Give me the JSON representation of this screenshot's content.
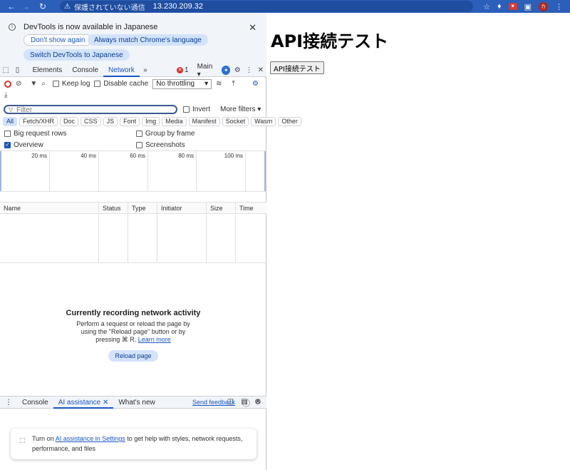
{
  "browser": {
    "security_warning": "保護されていない通信",
    "url": "13.230.209.32",
    "profile_initial": "カ"
  },
  "infobar": {
    "message": "DevTools is now available in Japanese",
    "dont_show": "Don't show again",
    "always_match": "Always match Chrome's language",
    "switch": "Switch DevTools to Japanese"
  },
  "devtools_tabs": {
    "elements": "Elements",
    "console": "Console",
    "network": "Network",
    "error_count": "1",
    "context": "Main"
  },
  "network_toolbar": {
    "preserve_log": "Keep log",
    "disable_cache": "Disable cache",
    "throttling": "No throttling"
  },
  "filter": {
    "placeholder": "Filter",
    "invert": "Invert",
    "more_filters": "More filters"
  },
  "types": [
    "All",
    "Fetch/XHR",
    "Doc",
    "CSS",
    "JS",
    "Font",
    "Img",
    "Media",
    "Manifest",
    "Socket",
    "Wasm",
    "Other"
  ],
  "options": {
    "big_rows": "Big request rows",
    "group_by_frame": "Group by frame",
    "overview": "Overview",
    "screenshots": "Screenshots"
  },
  "timeline_ticks": [
    "20 ms",
    "40 ms",
    "60 ms",
    "80 ms",
    "100 ms"
  ],
  "table_columns": [
    "Name",
    "Status",
    "Type",
    "Initiator",
    "Size",
    "Time"
  ],
  "empty_state": {
    "heading": "Currently recording network activity",
    "line1": "Perform a request or reload the page by",
    "line2": "using the \"Reload page\" button or by",
    "line3": "pressing ⌘ R.",
    "learn_more": "Learn more",
    "reload_button": "Reload page"
  },
  "drawer": {
    "console": "Console",
    "ai_assistance": "AI assistance",
    "whats_new": "What's new",
    "send_feedback": "Send feedback",
    "card_turn_on": "Turn on",
    "card_link": "AI assistance in Settings",
    "card_rest1": "to get help with styles, network requests,",
    "card_rest2": "performance, and files"
  },
  "page": {
    "title": "API接続テスト",
    "button": "API接続テスト"
  }
}
